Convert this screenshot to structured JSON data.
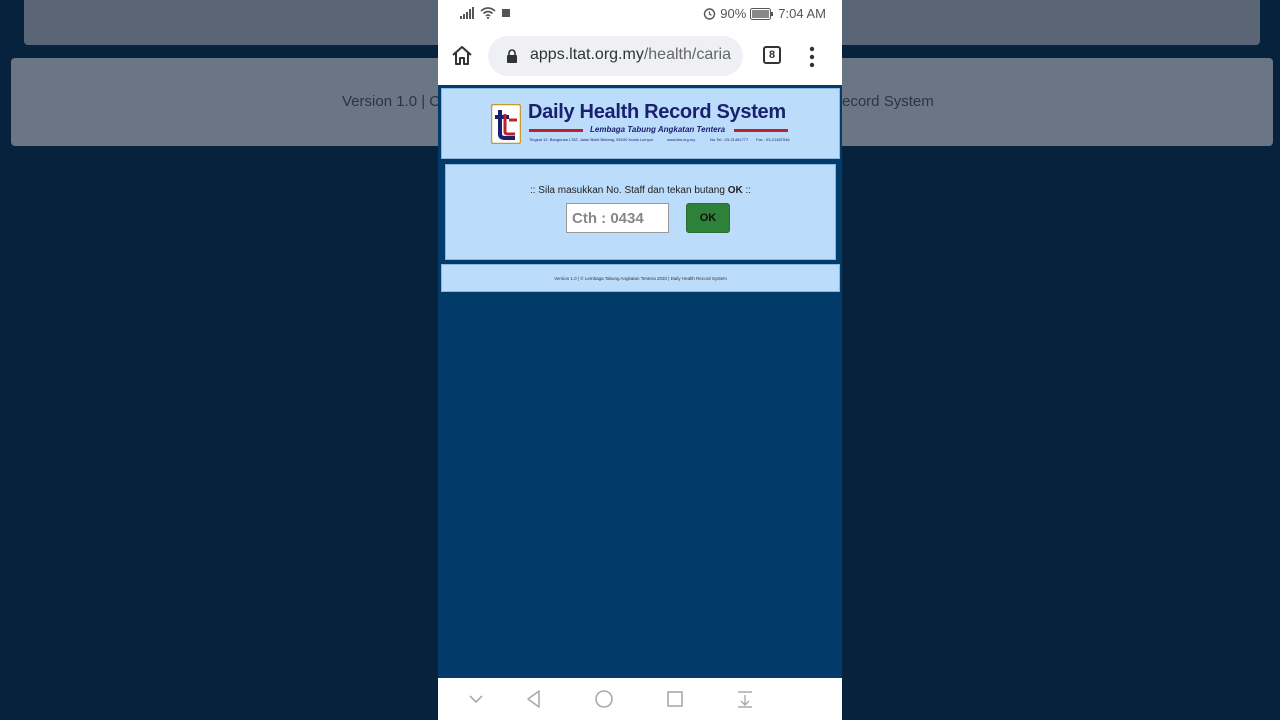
{
  "background": {
    "left_text": "Version 1.0 | C",
    "right_text": "ecord System"
  },
  "status_bar": {
    "battery": "90%",
    "time": "7:04 AM"
  },
  "browser": {
    "url_domain": "apps.ltat.org.my",
    "url_path": "/health/caria",
    "tab_count": "8"
  },
  "header": {
    "title": "Daily Health Record System",
    "subtitle": "Lembaga Tabung Angkatan Tentera",
    "address": "Tingkat 12, Bangunan LTAT, Jalan Bukit Bintang, 55100 Kuala Lumpur",
    "website": "www.ltat.org.my",
    "phone": "No.Tel : 03-21481777",
    "fax": "Fax : 03-21487946"
  },
  "form": {
    "instruction_prefix": ":: Sila masukkan No. Staff dan tekan butang ",
    "instruction_bold": "OK",
    "instruction_suffix": " ::",
    "staff_placeholder": "Cth : 0434",
    "ok_label": "OK"
  },
  "footer": {
    "text": "Version 1.0 | © Lembaga Tabung Angkatan Tentera 2020 | Daily Health Record System"
  },
  "colors": {
    "page_bg": "#023b69",
    "card_bg": "#bcdcfb",
    "ok_button": "#2e8138",
    "brand_navy": "#1a1f6e",
    "brand_red": "#c0202b"
  }
}
